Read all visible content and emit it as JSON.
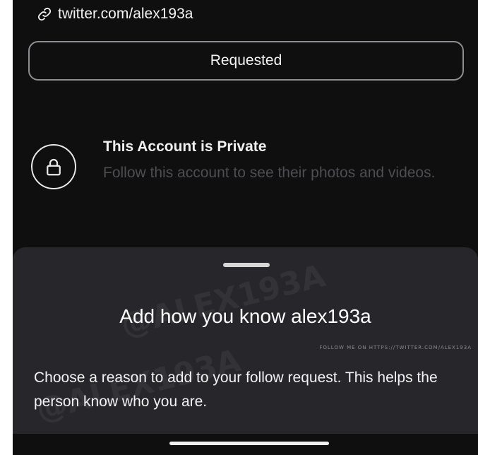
{
  "profile": {
    "link_text": "twitter.com/alex193a",
    "link_icon": "link-icon",
    "requested_label": "Requested"
  },
  "private_notice": {
    "icon": "lock-icon",
    "title": "This Account is Private",
    "subtitle": "Follow this account to see their photos and videos."
  },
  "sheet": {
    "title": "Add how you know alex193a",
    "description": "Choose a reason to add to your follow request. This helps the person know who you are."
  },
  "watermark": {
    "line": "FOLLOW ME ON HTTPS://TWITTER.COM/ALEX193A",
    "mark": "@ALEX193A"
  },
  "colors": {
    "background": "#0f0f10",
    "sheet": "#27272b",
    "muted_text": "#4d4d52",
    "border": "#8e8e93"
  }
}
